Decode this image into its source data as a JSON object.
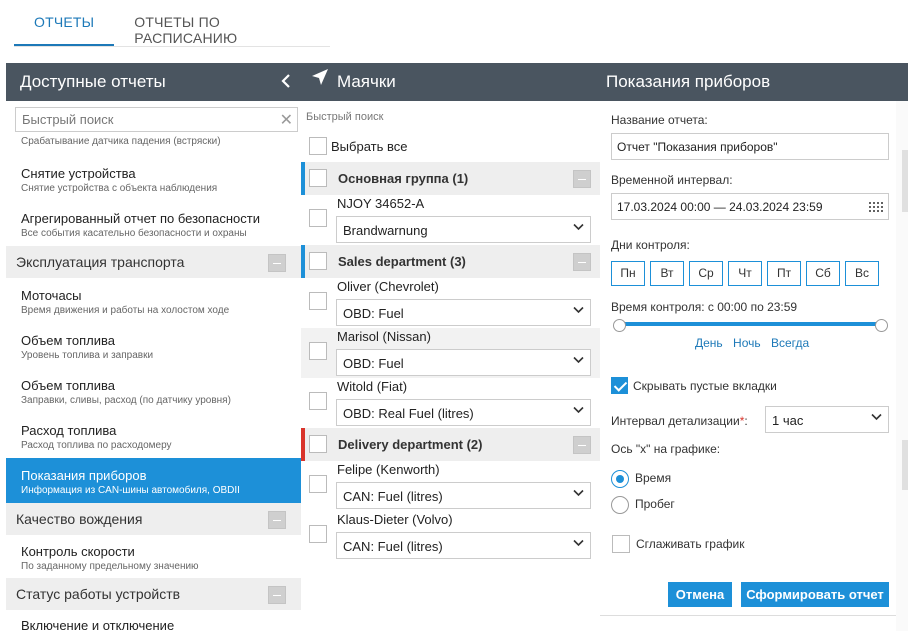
{
  "top_tabs": [
    {
      "label": "ОТЧЕТЫ",
      "active": true
    },
    {
      "label": "ОТЧЕТЫ ПО РАСПИСАНИЮ",
      "active": false
    }
  ],
  "available_reports": {
    "title": "Доступные отчеты",
    "collapse_icon": "chevron-left-icon",
    "search_placeholder": "Быстрый поиск",
    "clear_icon": "close-icon",
    "items": [
      {
        "type": "item",
        "title": "",
        "subtitle": "Срабатывание датчика падения (встряски)"
      },
      {
        "type": "item",
        "title": "Снятие устройства",
        "subtitle": "Снятие устройства с объекта наблюдения"
      },
      {
        "type": "item",
        "title": "Агрегированный отчет по безопасности",
        "subtitle": "Все события касательно безопасности и охраны"
      },
      {
        "type": "category",
        "title": "Эксплуатация транспорта"
      },
      {
        "type": "item",
        "title": "Моточасы",
        "subtitle": "Время движения и работы на холостом ходе"
      },
      {
        "type": "item",
        "title": "Объем топлива",
        "subtitle": "Уровень топлива и заправки"
      },
      {
        "type": "item",
        "title": "Объем топлива",
        "subtitle": "Заправки, сливы, расход (по датчику уровня)"
      },
      {
        "type": "item",
        "title": "Расход топлива",
        "subtitle": "Расход топлива по расходомеру"
      },
      {
        "type": "item",
        "title": "Показания приборов",
        "subtitle": "Информация из CAN-шины автомобиля, OBDII",
        "active": true
      },
      {
        "type": "category",
        "title": "Качество вождения"
      },
      {
        "type": "item",
        "title": "Контроль скорости",
        "subtitle": "По заданному предельному значению"
      },
      {
        "type": "category",
        "title": "Статус работы устройств"
      },
      {
        "type": "item",
        "title": "Включение и отключение",
        "subtitle": ""
      }
    ]
  },
  "beacons": {
    "title": "Маячки",
    "title_icon": "navigation-arrow-icon",
    "search_placeholder": "Быстрый поиск",
    "select_all_label": "Выбрать все",
    "groups": [
      {
        "name": "Основная группа (1)",
        "color": "#1d90d8",
        "units": [
          {
            "name": "NJOY 34652-A",
            "sensor": "Brandwarnung"
          }
        ]
      },
      {
        "name": "Sales department (3)",
        "color": "#1d90d8",
        "units": [
          {
            "name": "Oliver (Chevrolet)",
            "sensor": "OBD: Fuel"
          },
          {
            "name": "Marisol (Nissan)",
            "sensor": "OBD: Fuel"
          },
          {
            "name": "Witold (Fiat)",
            "sensor": "OBD: Real Fuel (litres)"
          }
        ]
      },
      {
        "name": "Delivery department (2)",
        "color": "#d9342b",
        "units": [
          {
            "name": "Felipe (Kenworth)",
            "sensor": "CAN: Fuel (litres)"
          },
          {
            "name": "Klaus-Dieter (Volvo)",
            "sensor": "CAN: Fuel (litres)"
          }
        ]
      }
    ]
  },
  "settings": {
    "title": "Показания приборов",
    "report_name_label": "Название отчета:",
    "report_name_value": "Отчет \"Показания приборов\"",
    "interval_label": "Временной интервал:",
    "interval_value": "17.03.2024 00:00 — 24.03.2024 23:59",
    "calendar_icon": "calendar-grid-icon",
    "days_label": "Дни контроля:",
    "days": [
      "Пн",
      "Вт",
      "Ср",
      "Чт",
      "Пт",
      "Сб",
      "Вс"
    ],
    "time_label": "Время контроля: с 00:00 по 23:59",
    "quick_links": [
      "День",
      "Ночь",
      "Всегда"
    ],
    "hide_empty_label": "Скрывать пустые вкладки",
    "hide_empty_checked": true,
    "detail_label": "Интервал детализации",
    "detail_required_mark": "*",
    "detail_colon": ":",
    "detail_value": "1 час",
    "axis_label": "Ось \"х\" на графике:",
    "axis_options": [
      {
        "label": "Время",
        "selected": true
      },
      {
        "label": "Пробег",
        "selected": false
      }
    ],
    "smooth_label": "Сглаживать график",
    "smooth_checked": false,
    "cancel_label": "Отмена",
    "submit_label": "Сформировать отчет",
    "accent_color": "#1d90d8",
    "header_color": "#4a5560"
  }
}
